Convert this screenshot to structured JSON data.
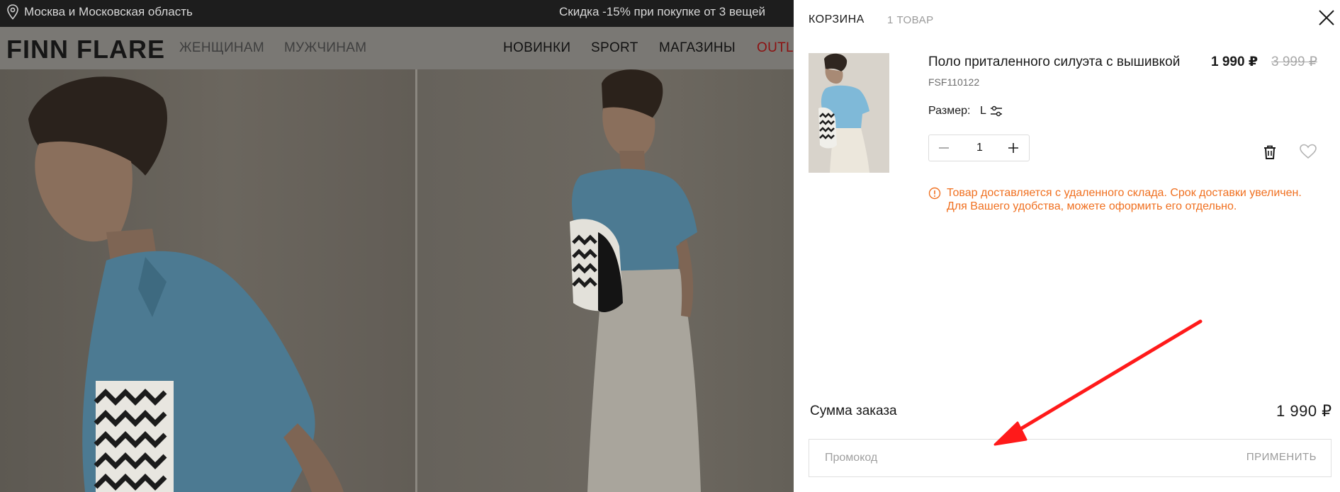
{
  "site": {
    "location": "Москва и Московская область",
    "promo_banner": "Скидка -15% при покупке от 3 вещей",
    "logo": "FINN FLARE",
    "nav": {
      "women": "ЖЕНЩИНАМ",
      "men": "МУЖЧИНАМ",
      "new": "НОВИНКИ",
      "sport": "SPORT",
      "stores": "МАГАЗИНЫ",
      "outlet": "OUTL"
    }
  },
  "cart": {
    "title": "КОРЗИНА",
    "count": "1 ТОВАР",
    "item": {
      "name": "Поло приталенного силуэта с вышивкой",
      "sku": "FSF110122",
      "price": "1 990 ₽",
      "old_price": "3 999 ₽",
      "size_label": "Размер:",
      "size_value": "L",
      "quantity": "1",
      "notice": "Товар доставляется с удаленного склада. Срок доставки увеличен. Для Вашего удобства, можете оформить его отдельно."
    },
    "summary": {
      "label": "Сумма заказа",
      "value": "1 990 ₽"
    },
    "promo": {
      "placeholder": "Промокод",
      "apply": "ПРИМЕНИТЬ"
    }
  },
  "colors": {
    "notice": "#f07020",
    "annotation_arrow": "#ff1a1a",
    "outlet": "#8c1111"
  },
  "icons": [
    "location-pin-icon",
    "close-icon",
    "size-filter-icon",
    "minus-icon",
    "plus-icon",
    "trash-icon",
    "heart-icon",
    "info-icon"
  ]
}
